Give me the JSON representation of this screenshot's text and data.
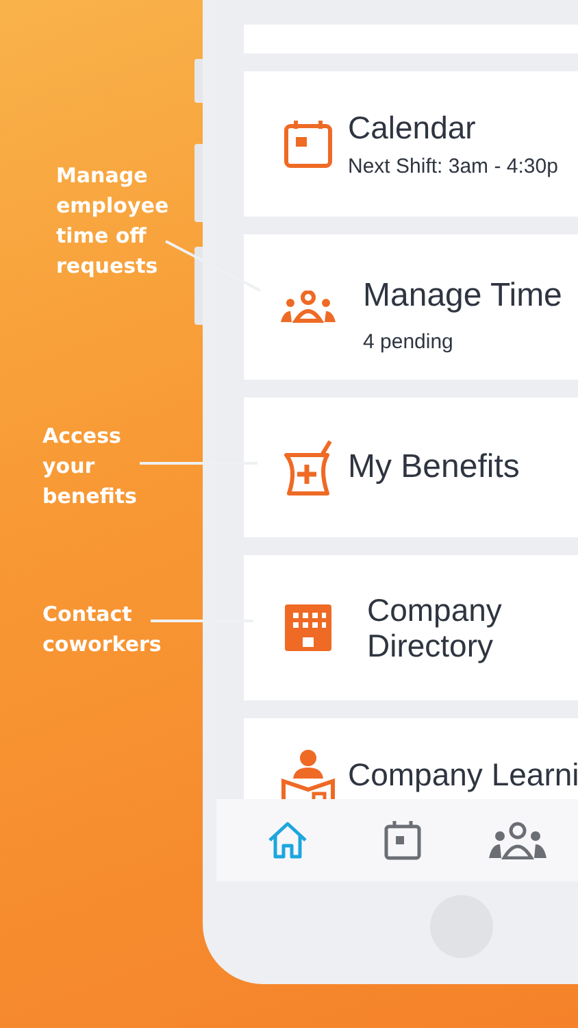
{
  "callouts": [
    {
      "text": "Manage employee time off requests"
    },
    {
      "text": "Access your benefits"
    },
    {
      "text": "Contact coworkers"
    }
  ],
  "tiles": [
    {
      "kind": "blank"
    },
    {
      "kind": "calendar",
      "title": "Calendar",
      "subtitle": "Next Shift: 3am - 4:30p"
    },
    {
      "kind": "team",
      "title": "Manage Time",
      "subtitle": "4 pending"
    },
    {
      "kind": "benefits",
      "title": "My Benefits"
    },
    {
      "kind": "directory",
      "title": "Company Directory"
    },
    {
      "kind": "learning",
      "title": "Company Learni"
    }
  ],
  "nav": [
    {
      "kind": "home",
      "selected": true
    },
    {
      "kind": "calendar",
      "selected": false
    },
    {
      "kind": "team",
      "selected": false
    }
  ]
}
